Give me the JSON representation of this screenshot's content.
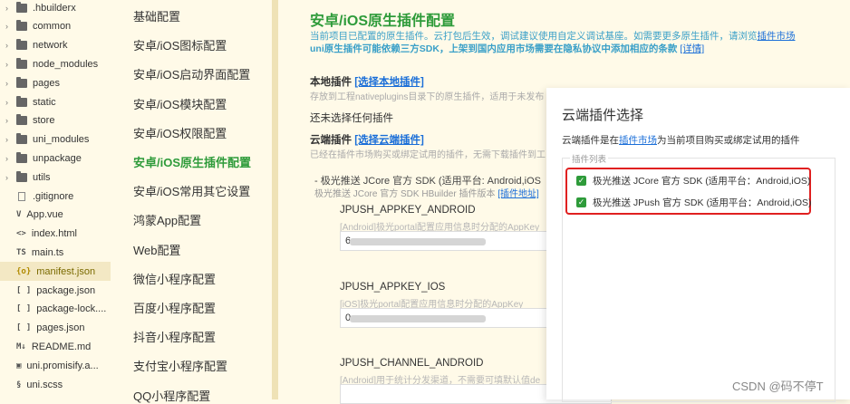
{
  "file_tree": [
    {
      "name": ".hbuilderx",
      "type": "folder"
    },
    {
      "name": "common",
      "type": "folder"
    },
    {
      "name": "network",
      "type": "folder"
    },
    {
      "name": "node_modules",
      "type": "folder"
    },
    {
      "name": "pages",
      "type": "folder"
    },
    {
      "name": "static",
      "type": "folder"
    },
    {
      "name": "store",
      "type": "folder"
    },
    {
      "name": "uni_modules",
      "type": "folder"
    },
    {
      "name": "unpackage",
      "type": "folder"
    },
    {
      "name": "utils",
      "type": "folder"
    },
    {
      "name": ".gitignore",
      "type": "file",
      "icon": "file-icon"
    },
    {
      "name": "App.vue",
      "type": "file",
      "icon": "vue-file-icon",
      "glyph": "V"
    },
    {
      "name": "index.html",
      "type": "file",
      "icon": "html-file-icon",
      "glyph": "<>"
    },
    {
      "name": "main.ts",
      "type": "file",
      "icon": "ts-file-icon",
      "glyph": "TS"
    },
    {
      "name": "manifest.json",
      "type": "file",
      "icon": "json-file-icon",
      "glyph": "{o}",
      "active": true
    },
    {
      "name": "package.json",
      "type": "file",
      "icon": "json-file-icon",
      "glyph": "[ ]"
    },
    {
      "name": "package-lock....",
      "type": "file",
      "icon": "json-file-icon",
      "glyph": "[ ]"
    },
    {
      "name": "pages.json",
      "type": "file",
      "icon": "json-file-icon",
      "glyph": "[ ]"
    },
    {
      "name": "README.md",
      "type": "file",
      "icon": "markdown-file-icon",
      "glyph": "M↓"
    },
    {
      "name": "uni.promisify.a...",
      "type": "file",
      "icon": "js-file-icon",
      "glyph": "▣"
    },
    {
      "name": "uni.scss",
      "type": "file",
      "icon": "scss-file-icon",
      "glyph": "§"
    }
  ],
  "nav": [
    {
      "label": "基础配置"
    },
    {
      "label": "安卓/iOS图标配置"
    },
    {
      "label": "安卓/iOS启动界面配置"
    },
    {
      "label": "安卓/iOS模块配置"
    },
    {
      "label": "安卓/iOS权限配置"
    },
    {
      "label": "安卓/iOS原生插件配置",
      "active": true
    },
    {
      "label": "安卓/iOS常用其它设置"
    },
    {
      "label": "鸿蒙App配置"
    },
    {
      "label": "Web配置"
    },
    {
      "label": "微信小程序配置"
    },
    {
      "label": "百度小程序配置"
    },
    {
      "label": "抖音小程序配置"
    },
    {
      "label": "支付宝小程序配置"
    },
    {
      "label": "QQ小程序配置"
    }
  ],
  "main": {
    "title": "安卓/iOS原生插件配置",
    "desc1_prefix": "当前项目已配置的原生插件。云打包后生效，调试建议使用自定义调试基座。如需要更多原生插件，请浏览",
    "desc1_link": "插件市场",
    "desc2_prefix": "uni原生插件可能依赖三方SDK，上架到国内应用市场需要在隐私协议中添加相应的条款",
    "desc2_link": "[详情]",
    "local_title": "本地插件",
    "local_link": "[选择本地插件]",
    "local_hint": "存放到工程nativeplugins目录下的原生插件，适用于未发布",
    "local_empty": "还未选择任何插件",
    "cloud_title": "云端插件",
    "cloud_link": "[选择云端插件]",
    "cloud_hint": "已经在插件市场购买或绑定试用的插件，无需下载插件到工",
    "plugin_line": "- 极光推送 JCore 官方 SDK (适用平台: Android,iOS",
    "plugin_sub_prefix": "极光推送 JCore 官方 SDK HBuilder 插件版本",
    "plugin_sub_link": "[插件地址]",
    "fields": [
      {
        "label": "JPUSH_APPKEY_ANDROID",
        "hint": "[Android]极光portal配置应用信息时分配的AppKey",
        "value": "6"
      },
      {
        "label": "JPUSH_APPKEY_IOS",
        "hint": "[iOS]极光portal配置应用信息时分配的AppKey",
        "value": "0"
      },
      {
        "label": "JPUSH_CHANNEL_ANDROID",
        "hint": "[Android]用于统计分发渠道，不需要可填默认值de",
        "value": ""
      }
    ]
  },
  "dialog": {
    "title": "云端插件选择",
    "desc_prefix": "云端插件是在",
    "desc_link": "插件市场",
    "desc_suffix": "为当前项目购买或绑定试用的插件",
    "list_legend": "插件列表",
    "items": [
      {
        "label": "极光推送 JCore 官方 SDK (适用平台：Android,iOS)",
        "checked": true
      },
      {
        "label": "极光推送 JPush 官方 SDK (适用平台：Android,iOS)",
        "checked": true
      }
    ]
  },
  "watermark": "CSDN @码不停T",
  "colors": {
    "accent_green": "#2e9b3a",
    "link_blue": "#1a6ed8",
    "highlight_red": "#e02020",
    "bg": "#fffae8"
  }
}
